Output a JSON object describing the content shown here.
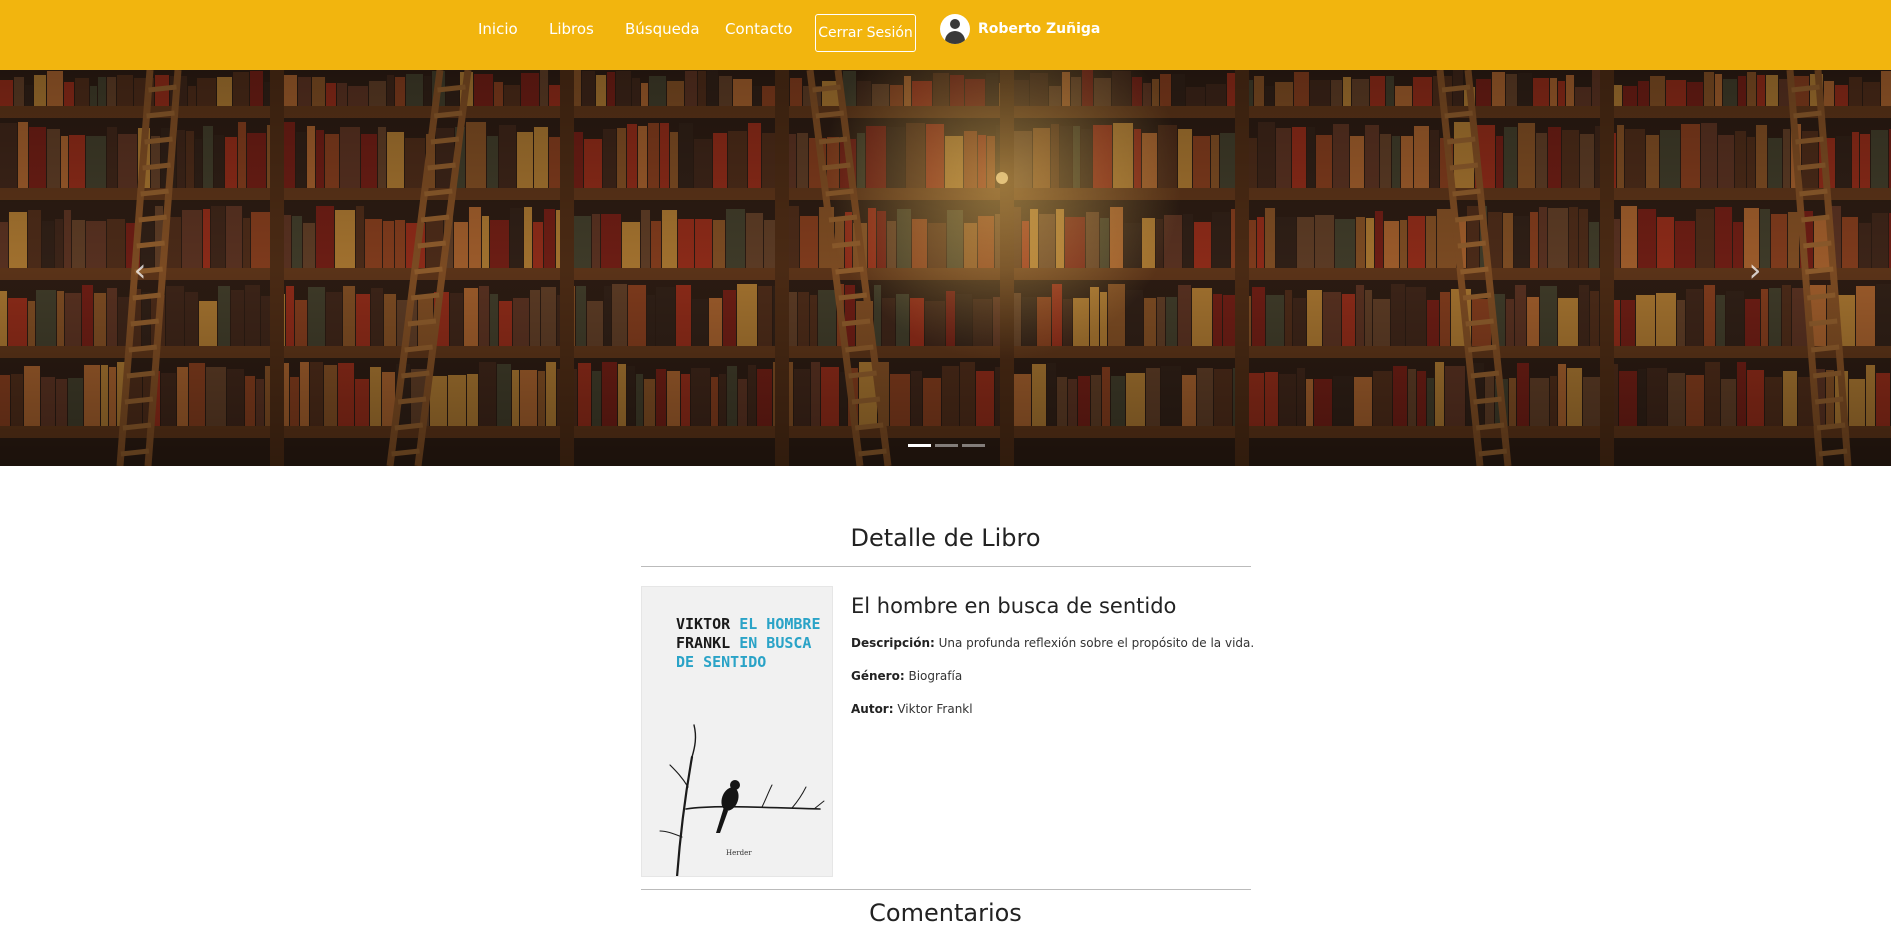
{
  "nav": {
    "links": [
      "Inicio",
      "Libros",
      "Búsqueda",
      "Contacto"
    ],
    "logout_label": "Cerrar Sesión",
    "user_name": "Roberto Zuñiga"
  },
  "carousel": {
    "slide_count": 3,
    "active_index": 0,
    "prev_icon": "chevron-left-icon",
    "next_icon": "chevron-right-icon"
  },
  "detail": {
    "section_title": "Detalle de Libro",
    "book_title": "El hombre en busca de sentido",
    "description_label": "Descripción:",
    "description": "Una profunda reflexión sobre el propósito de la vida.",
    "genre_label": "Género:",
    "genre": "Biografía",
    "author_label": "Autor:",
    "author": "Viktor Frankl",
    "cover": {
      "author_line1": "VIKTOR",
      "author_line2": "FRANKL",
      "title_line1": "EL HOMBRE",
      "title_line2": "EN BUSCA",
      "title_line3": "DE SENTIDO",
      "publisher": "Herder"
    }
  },
  "comments": {
    "section_title": "Comentarios"
  },
  "colors": {
    "navbar": "#f2b50e",
    "cover_title": "#2aa3c7"
  }
}
